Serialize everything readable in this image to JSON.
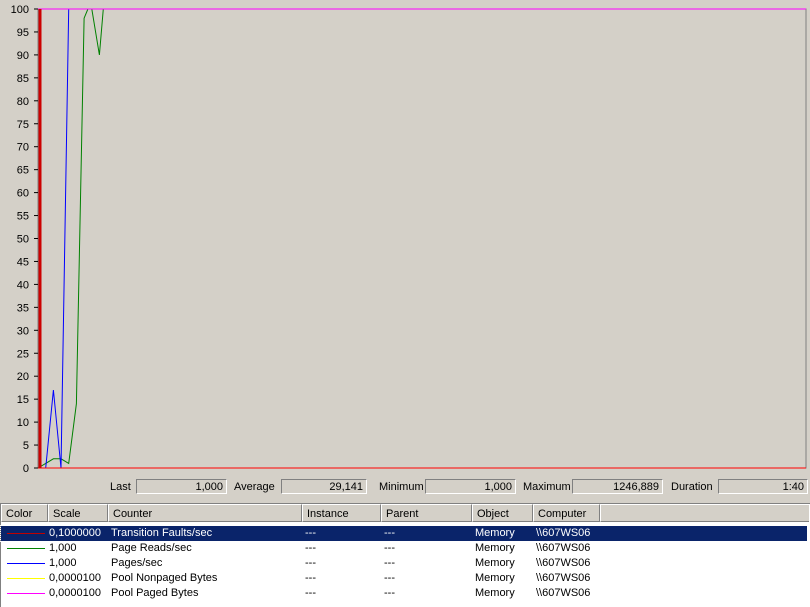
{
  "chart_data": {
    "type": "line",
    "ylim": [
      0,
      100
    ],
    "yticks": [
      "0",
      "5",
      "10",
      "15",
      "20",
      "25",
      "30",
      "35",
      "40",
      "45",
      "50",
      "55",
      "60",
      "65",
      "70",
      "75",
      "80",
      "85",
      "90",
      "95",
      "100"
    ],
    "grid": false,
    "background": "#d4d0c8",
    "time_cursor_color": "#cc0000",
    "series": [
      {
        "color": "#00ff00",
        "x": [
          0,
          1,
          4,
          6,
          8,
          9,
          10,
          11,
          12,
          14,
          16,
          17,
          18,
          19,
          20,
          21,
          22,
          26,
          28,
          30,
          32,
          34,
          36,
          38,
          40,
          42,
          44,
          46,
          48,
          50,
          52,
          54,
          56,
          58,
          60,
          62,
          64,
          66,
          68,
          70,
          72,
          74,
          75,
          76,
          77,
          78,
          79,
          80,
          81,
          82,
          84,
          86,
          88,
          89,
          90,
          91,
          92,
          93,
          94,
          96,
          98,
          100
        ],
        "y": [
          0,
          0,
          0,
          0,
          0,
          0,
          0,
          0,
          0,
          0,
          0,
          0,
          0,
          0,
          0,
          0,
          0,
          0,
          0,
          0,
          0,
          0,
          0,
          0,
          0,
          0,
          0,
          0,
          0,
          0,
          0,
          0,
          0,
          0,
          0,
          0,
          0,
          0,
          0,
          0,
          0,
          0,
          0,
          0,
          0,
          0,
          0,
          0,
          0,
          0,
          0,
          0,
          0,
          0,
          0,
          0,
          0,
          0,
          0,
          0,
          0,
          0
        ]
      },
      {
        "color": "#008000",
        "x": [
          0,
          1,
          2,
          3,
          4,
          5,
          6,
          6.5,
          7,
          8,
          8.5,
          9,
          9.5,
          10,
          10.5,
          11,
          11.5,
          12,
          12.5,
          13,
          14,
          15,
          16,
          17,
          18,
          19,
          20,
          21,
          22,
          23,
          24,
          25,
          26,
          27,
          28,
          29,
          30,
          31,
          32,
          32.5,
          33,
          34,
          34.5,
          35,
          35.5,
          36,
          37,
          38,
          40,
          42,
          44,
          46,
          48,
          50,
          52,
          53,
          54,
          56,
          58,
          60,
          62,
          62.5,
          63,
          63.5,
          64,
          64.5,
          65,
          66,
          67,
          68,
          70,
          72,
          74,
          76,
          78,
          80,
          82,
          84,
          86,
          88,
          90,
          92,
          94,
          96,
          98,
          100
        ],
        "y": [
          0,
          1,
          2,
          2,
          1,
          14,
          98,
          100,
          100,
          90,
          100,
          100,
          100,
          100,
          100,
          100,
          100,
          100,
          100,
          100,
          100,
          100,
          100,
          100,
          100,
          100,
          100,
          100,
          100,
          100,
          100,
          100,
          100,
          100,
          100,
          100,
          100,
          100,
          100,
          100,
          100,
          100,
          100,
          100,
          100,
          100,
          100,
          100,
          100,
          100,
          100,
          100,
          100,
          100,
          100,
          100,
          100,
          100,
          100,
          100,
          100,
          100,
          100,
          100,
          100,
          100,
          100,
          100,
          100,
          100,
          100,
          100,
          100,
          100,
          100,
          100,
          100,
          100,
          100,
          100,
          100,
          100,
          100,
          100,
          100,
          100
        ]
      },
      {
        "color": "#0000ff",
        "x": [
          0,
          1,
          2,
          3,
          4,
          5,
          6,
          7,
          8,
          9,
          10,
          11,
          12,
          13,
          14,
          15,
          16,
          17,
          18,
          19,
          20,
          21,
          22,
          23,
          24,
          25,
          26,
          27,
          28,
          29,
          30,
          31,
          32,
          33,
          34,
          35,
          36,
          37,
          38,
          39,
          40,
          41,
          42,
          43,
          44,
          45,
          46,
          47,
          48,
          49,
          50,
          51,
          52,
          53,
          54,
          55,
          56,
          57,
          58,
          59,
          60,
          61,
          62,
          63,
          64,
          65,
          66,
          67,
          68,
          69,
          70,
          71,
          72,
          73,
          74,
          75,
          76,
          77,
          78,
          79,
          80,
          81,
          82,
          83,
          84,
          85,
          86,
          87,
          88,
          89,
          90,
          91,
          92,
          93,
          94,
          95,
          96,
          97,
          98,
          99,
          100
        ],
        "y": [
          0,
          0,
          17,
          0,
          100,
          100,
          100,
          100,
          100,
          100,
          100,
          100,
          100,
          100,
          100,
          100,
          100,
          100,
          100,
          100,
          100,
          100,
          100,
          100,
          100,
          100,
          100,
          100,
          100,
          100,
          100,
          100,
          100,
          100,
          100,
          100,
          100,
          100,
          100,
          100,
          100,
          100,
          100,
          100,
          100,
          100,
          100,
          100,
          100,
          100,
          100,
          100,
          100,
          100,
          100,
          100,
          100,
          100,
          100,
          100,
          100,
          100,
          100,
          100,
          100,
          100,
          100,
          100,
          100,
          100,
          100,
          100,
          100,
          100,
          100,
          100,
          100,
          100,
          100,
          100,
          100,
          100,
          100,
          100,
          100,
          100,
          100,
          100,
          100,
          100,
          100,
          100,
          100,
          100,
          100,
          100,
          100,
          100,
          100,
          100,
          100
        ]
      },
      {
        "color": "#ff0000",
        "x": [
          0,
          1,
          2,
          3,
          4,
          5,
          6,
          7,
          8,
          9,
          10,
          11,
          12,
          13,
          14,
          15,
          16,
          17,
          18,
          19,
          20,
          21,
          22,
          23,
          24,
          25,
          26,
          27,
          28,
          29,
          30,
          31,
          32,
          33,
          34,
          35,
          36,
          37,
          38,
          39,
          40,
          41,
          42,
          43,
          44,
          45,
          46,
          47,
          48,
          49,
          50,
          51,
          52,
          53,
          54,
          55,
          56,
          57,
          58,
          59,
          60,
          61,
          62,
          63,
          64,
          65,
          66,
          67,
          68,
          69,
          70,
          71,
          72,
          73,
          74,
          75,
          76,
          77,
          78,
          79,
          80,
          81,
          82,
          83,
          84,
          85,
          86,
          87,
          88,
          89,
          90,
          91,
          92,
          93,
          94,
          95,
          96,
          97,
          98,
          99,
          100
        ],
        "y": [
          0,
          0,
          0,
          0,
          0,
          0,
          0,
          0,
          0,
          0,
          0,
          0,
          0,
          0,
          0,
          0,
          0,
          0,
          0,
          0,
          0,
          0,
          0,
          0,
          0,
          0,
          0,
          0,
          0,
          0,
          0,
          0,
          0,
          0,
          0,
          0,
          0,
          0,
          0,
          0,
          0,
          0,
          0,
          0,
          0,
          0,
          0,
          0,
          0,
          0,
          0,
          0,
          0,
          0,
          0,
          0,
          0,
          0,
          0,
          0,
          0,
          0,
          0,
          0,
          0,
          0,
          0,
          0,
          0,
          0,
          0,
          0,
          0,
          0,
          0,
          0,
          0,
          0,
          0,
          0,
          0,
          0,
          0,
          0,
          0,
          0,
          0,
          0,
          0,
          0,
          0,
          0,
          0,
          0,
          0,
          0,
          0,
          0,
          0,
          0,
          0
        ]
      },
      {
        "color": "#ff00ff",
        "x": [
          0,
          100
        ],
        "y": [
          100,
          100
        ]
      }
    ]
  },
  "stats": {
    "last_label": "Last",
    "last_value": "1,000",
    "average_label": "Average",
    "average_value": "29,141",
    "minimum_label": "Minimum",
    "minimum_value": "1,000",
    "maximum_label": "Maximum",
    "maximum_value": "1246,889",
    "duration_label": "Duration",
    "duration_value": "1:40"
  },
  "legend": {
    "headers": [
      "Color",
      "Scale",
      "Counter",
      "Instance",
      "Parent",
      "Object",
      "Computer"
    ],
    "rows": [
      {
        "color": "#c00000",
        "scale": "0,1000000",
        "counter": "Transition Faults/sec",
        "instance": "---",
        "parent": "---",
        "object": "Memory",
        "computer": "\\\\607WS06",
        "selected": true
      },
      {
        "color": "#008000",
        "scale": "1,000",
        "counter": "Page Reads/sec",
        "instance": "---",
        "parent": "---",
        "object": "Memory",
        "computer": "\\\\607WS06",
        "selected": false
      },
      {
        "color": "#0000ff",
        "scale": "1,000",
        "counter": "Pages/sec",
        "instance": "---",
        "parent": "---",
        "object": "Memory",
        "computer": "\\\\607WS06",
        "selected": false
      },
      {
        "color": "#ffff00",
        "scale": "0,0000100",
        "counter": "Pool Nonpaged Bytes",
        "instance": "---",
        "parent": "---",
        "object": "Memory",
        "computer": "\\\\607WS06",
        "selected": false
      },
      {
        "color": "#ff00ff",
        "scale": "0,0000100",
        "counter": "Pool Paged Bytes",
        "instance": "---",
        "parent": "---",
        "object": "Memory",
        "computer": "\\\\607WS06",
        "selected": false
      }
    ]
  }
}
